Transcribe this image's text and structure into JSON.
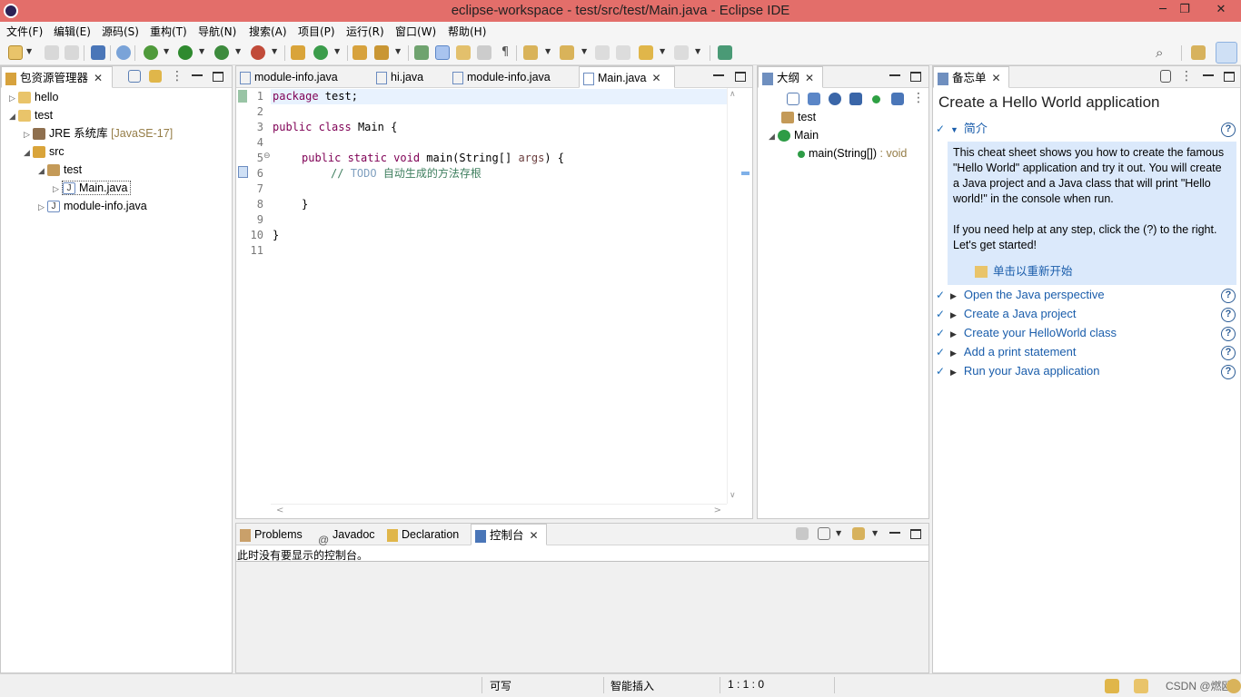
{
  "window": {
    "title": "eclipse-workspace - test/src/test/Main.java - Eclipse IDE",
    "minimize": "─",
    "restore": "❐",
    "close": "✕"
  },
  "menu": [
    "文件(F)",
    "编辑(E)",
    "源码(S)",
    "重构(T)",
    "导航(N)",
    "搜索(A)",
    "项目(P)",
    "运行(R)",
    "窗口(W)",
    "帮助(H)"
  ],
  "package_explorer": {
    "title": "包资源管理器",
    "tree": [
      {
        "label": "hello",
        "level": 0,
        "expanded": false
      },
      {
        "label": "test",
        "level": 0,
        "expanded": true
      },
      {
        "label": "JRE 系统库",
        "decoration": "[JavaSE-17]",
        "level": 1,
        "expanded": false
      },
      {
        "label": "src",
        "level": 1,
        "expanded": true
      },
      {
        "label": "test",
        "level": 2,
        "expanded": true
      },
      {
        "label": "Main.java",
        "level": 3,
        "expanded": false,
        "selected": true
      },
      {
        "label": "module-info.java",
        "level": 2,
        "expanded": false
      }
    ]
  },
  "editor": {
    "tabs": [
      "module-info.java",
      "hi.java",
      "module-info.java",
      "Main.java"
    ],
    "active_tab": "Main.java",
    "line_numbers": [
      "1",
      "2",
      "3",
      "4",
      "5",
      "6",
      "7",
      "8",
      "9",
      "10",
      "11"
    ],
    "lines": {
      "l1_kw": "package",
      "l1_rest": " test;",
      "l3_kw1": "public",
      "l3_kw2": " class",
      "l3_rest": " Main {",
      "l5_kw1": "public",
      "l5_kw2": " static",
      "l5_kw3": " void",
      "l5_rest": " main(String[] ",
      "l5_param": "args",
      "l5_end": ") {",
      "l6_slash": "// ",
      "l6_todo": "TODO",
      "l6_text": " 自动生成的方法存根",
      "l8": "}",
      "l10": "}"
    }
  },
  "outline": {
    "title": "大纲",
    "items": [
      {
        "label": "test"
      },
      {
        "label": "Main"
      },
      {
        "label": "main(String[])",
        "decoration": " : void"
      }
    ]
  },
  "cheatsheet": {
    "tab_title": "备忘单",
    "heading": "Create a Hello World application",
    "intro_title": "简介",
    "intro_p1": "This cheat sheet shows you how to create the famous \"Hello World\" application and try it out. You will create a Java project and a Java class that will print \"Hello world!\" in the console when run.",
    "intro_p2": "If you need help at any step, click the (?) to the right. Let's get started!",
    "restart_link": "单击以重新开始",
    "steps": [
      "Open the Java perspective",
      "Create a Java project",
      "Create your HelloWorld class",
      "Add a print statement",
      "Run your Java application"
    ],
    "help_glyph": "?"
  },
  "bottom": {
    "tabs": [
      "Problems",
      "Javadoc",
      "Declaration",
      "控制台"
    ],
    "active_tab": "控制台",
    "message": "此时没有要显示的控制台。"
  },
  "status": {
    "writable": "可写",
    "insert_mode": "智能插入",
    "position": "1 : 1 : 0",
    "watermark": "CSDN @燃欧"
  },
  "colors": {
    "titlebar": "#e36e6a",
    "keyword": "#7f0055",
    "comment": "#3f7f5f",
    "link": "#1a5dab",
    "intro_bg": "#dbe9fb"
  }
}
